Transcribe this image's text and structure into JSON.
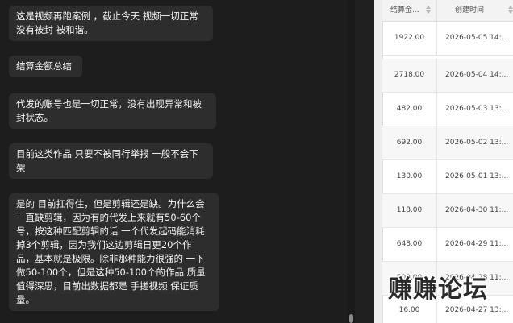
{
  "chat": {
    "messages": [
      {
        "text": "这是视频再跑案例 ，截止今天 视频一切正常\n没有被封 被和谐。"
      },
      {
        "text": "结算金额总结"
      },
      {
        "text": "代发的账号也是一切正常，没有出现异常和被\n封状态。"
      },
      {
        "text": "目前这类作品 只要不被同行举报  一般不会下\n架"
      },
      {
        "text": "是的 目前扛得住，但是剪辑还是缺。为什么会\n一直缺剪辑，因为有的代发上来就有50-60个\n号，按这种匹配剪辑的话 一个代发起码能消耗\n掉3个剪辑，因为我们这边剪辑日更20个作\n品，基本就是极限。除非那种能力很强的 一下\n做50-100个，但是这种50-100个的作品 质量\n值得深思，目前出数据都是 手搓视频 保证质\n量。"
      }
    ]
  },
  "table": {
    "headers": {
      "amount": "结算金...",
      "time": "创建时间"
    },
    "rows": [
      {
        "amount": "1922.00",
        "time": "2026-05-05 14:..."
      },
      {
        "amount": "2718.00",
        "time": "2026-05-04 14:..."
      },
      {
        "amount": "482.00",
        "time": "2026-05-03 13:..."
      },
      {
        "amount": "692.00",
        "time": "2026-05-02 13:..."
      },
      {
        "amount": "130.00",
        "time": "2026-05-01 13:..."
      },
      {
        "amount": "118.00",
        "time": "2026-04-30 11:..."
      },
      {
        "amount": "648.00",
        "time": "2026-04-29 11:..."
      },
      {
        "amount": "509.00",
        "time": "2026-04-28 11:..."
      },
      {
        "amount": "16.00",
        "time": "2026-04-27 13:..."
      }
    ]
  },
  "watermark": {
    "text": "赚赚论坛"
  },
  "colors": {
    "chat_bg": "#1d1d1d",
    "bubble_bg": "#2d2d2d",
    "table_bg": "#ffffff"
  }
}
